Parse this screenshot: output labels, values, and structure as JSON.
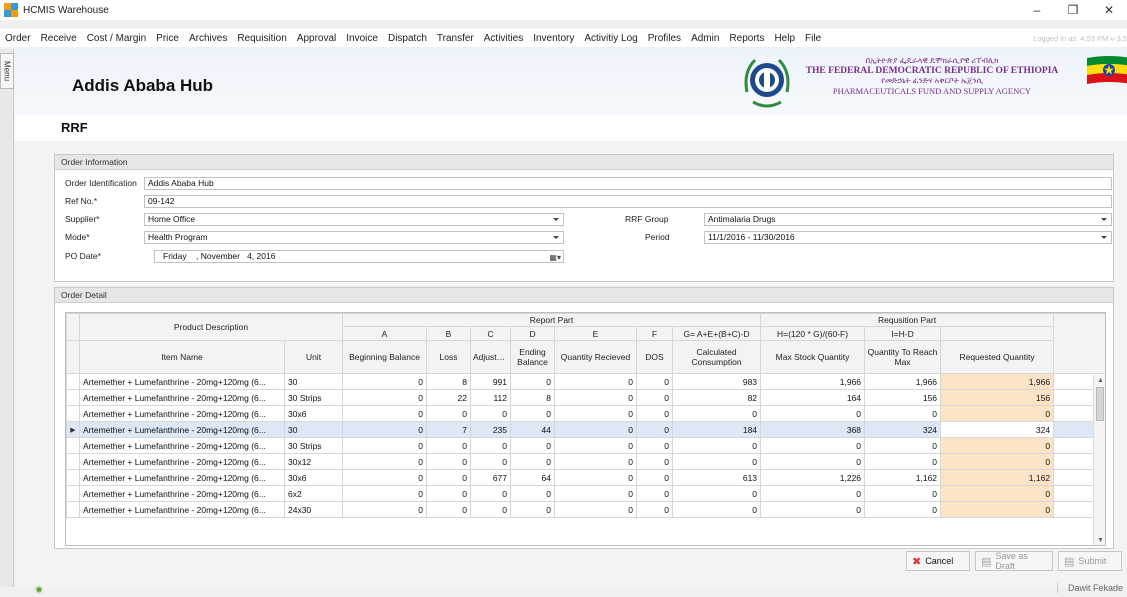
{
  "window": {
    "title": "HCMIS Warehouse",
    "minimize": "–",
    "maximize": "❐",
    "close": "✕"
  },
  "menu": {
    "items": [
      "Order",
      "Receive",
      "Cost / Margin",
      "Price",
      "Archives",
      "Requisition",
      "Approval",
      "Invoice",
      "Dispatch",
      "Transfer",
      "Activities",
      "Inventory",
      "Activitiy Log",
      "Profiles",
      "Admin",
      "Reports",
      "Help",
      "File"
    ],
    "logged_in": "Logged in as: 4:53 PM v-3.5"
  },
  "side_tab": {
    "label": "Menu"
  },
  "header": {
    "hub_name": "Addis Ababa Hub",
    "agency_amharic_1": "በኢትዮጵያ ፌዴራላዊ ዴሞክራሲያዊ ሪፐብሊክ",
    "agency_english_1": "THE FEDERAL DEMOCRATIC REPUBLIC OF ETHIOPIA",
    "agency_amharic_2": "የመድኃኒት ፈንድና አቅርቦት ኤጀንሲ",
    "agency_english_2": "PHARMACEUTICALS FUND AND SUPPLY AGENCY",
    "flag_colors": [
      "#078930",
      "#fcdd09",
      "#da121a"
    ],
    "emblem_color": "#1e4a8a"
  },
  "page": {
    "title": "RRF"
  },
  "order_info": {
    "title": "Order Information",
    "order_identification": {
      "label": "Order Identification",
      "value": "Addis Ababa Hub"
    },
    "ref_no": {
      "label": "Ref No.*",
      "value": "09-142"
    },
    "supplier": {
      "label": "Supplier*",
      "value": "Home Office"
    },
    "mode": {
      "label": "Mode*",
      "value": "Health Program"
    },
    "po_date": {
      "label": "PO Date*",
      "value": "Friday    , November   4, 2016"
    },
    "rrf_group": {
      "label": "RRF Group",
      "value": "Antimalaria Drugs"
    },
    "period": {
      "label": "Period",
      "value": "11/1/2016 - 11/30/2016"
    }
  },
  "order_detail": {
    "title": "Order Detail",
    "bands": {
      "product": "Product Description",
      "report": "Report Part",
      "requisition": "Requsition Part"
    },
    "letters": [
      "A",
      "B",
      "C",
      "D",
      "E",
      "F",
      "G= A+E+(B+C)-D",
      "H=(120 * G)/(60-F)",
      "I=H-D"
    ],
    "columns": [
      "Item Name",
      "Unit",
      "Beginning Balance",
      "Loss",
      "Adjustm...",
      "Ending Balance",
      "Quantity Recieved",
      "DOS",
      "Calculated Consumption",
      "Max Stock Quantity",
      "Quantity To Reach Max",
      "Requested Quantity"
    ],
    "rows": [
      {
        "item": "Artemether + Lumefanthrine - 20mg+120mg (6...",
        "unit": "30",
        "a": "0",
        "b": "8",
        "c": "991",
        "d": "0",
        "e": "0",
        "f": "0",
        "g": "983",
        "h": "1,966",
        "i": "1,966",
        "req": "1,966"
      },
      {
        "item": "Artemether + Lumefanthrine - 20mg+120mg (6...",
        "unit": "30 Strips",
        "a": "0",
        "b": "22",
        "c": "112",
        "d": "8",
        "e": "0",
        "f": "0",
        "g": "82",
        "h": "164",
        "i": "156",
        "req": "156"
      },
      {
        "item": "Artemether + Lumefanthrine - 20mg+120mg (6...",
        "unit": "30x6",
        "a": "0",
        "b": "0",
        "c": "0",
        "d": "0",
        "e": "0",
        "f": "0",
        "g": "0",
        "h": "0",
        "i": "0",
        "req": "0"
      },
      {
        "item": "Artemether + Lumefanthrine - 20mg+120mg (6...",
        "unit": "30",
        "a": "0",
        "b": "7",
        "c": "235",
        "d": "44",
        "e": "0",
        "f": "0",
        "g": "184",
        "h": "368",
        "i": "324",
        "req": "324"
      },
      {
        "item": "Artemether + Lumefanthrine - 20mg+120mg (6...",
        "unit": "30 Strips",
        "a": "0",
        "b": "0",
        "c": "0",
        "d": "0",
        "e": "0",
        "f": "0",
        "g": "0",
        "h": "0",
        "i": "0",
        "req": "0"
      },
      {
        "item": "Artemether + Lumefanthrine - 20mg+120mg (6...",
        "unit": "30x12",
        "a": "0",
        "b": "0",
        "c": "0",
        "d": "0",
        "e": "0",
        "f": "0",
        "g": "0",
        "h": "0",
        "i": "0",
        "req": "0"
      },
      {
        "item": "Artemether + Lumefanthrine - 20mg+120mg (6...",
        "unit": "30x6",
        "a": "0",
        "b": "0",
        "c": "677",
        "d": "64",
        "e": "0",
        "f": "0",
        "g": "613",
        "h": "1,226",
        "i": "1,162",
        "req": "1,162"
      },
      {
        "item": "Artemether + Lumefanthrine - 20mg+120mg (6...",
        "unit": "6x2",
        "a": "0",
        "b": "0",
        "c": "0",
        "d": "0",
        "e": "0",
        "f": "0",
        "g": "0",
        "h": "0",
        "i": "0",
        "req": "0"
      },
      {
        "item": "Artemether + Lumefanthrine - 20mg+120mg (6...",
        "unit": "24x30",
        "a": "0",
        "b": "0",
        "c": "0",
        "d": "0",
        "e": "0",
        "f": "0",
        "g": "0",
        "h": "0",
        "i": "0",
        "req": "0"
      }
    ],
    "selected_row_index": 3,
    "row_indicator": "▶",
    "requested_highlight_color": "#fde3c6"
  },
  "actions": {
    "cancel": "Cancel",
    "save_draft": "Save as Draft",
    "submit": "Submit"
  },
  "status": {
    "user": "Dawit Fekade"
  }
}
